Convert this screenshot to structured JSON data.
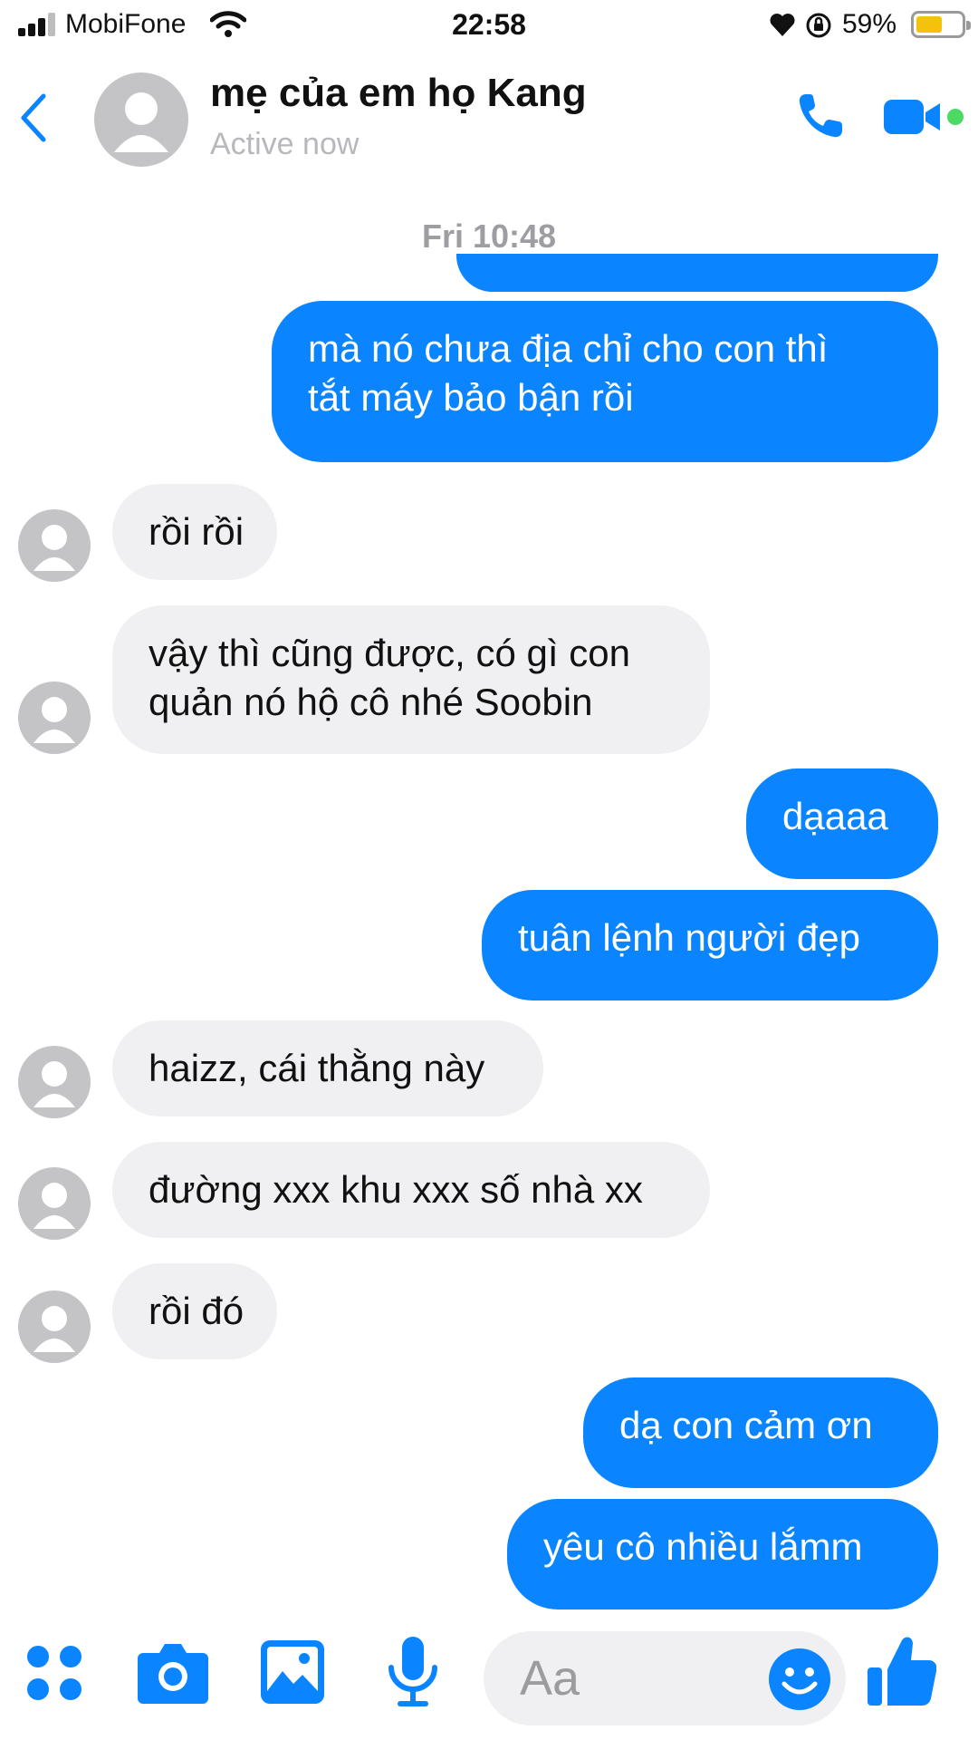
{
  "status_bar": {
    "carrier": "MobiFone",
    "time": "22:58",
    "battery_percent": "59%",
    "battery_level": 0.59,
    "icons": [
      "signal-icon",
      "wifi-icon",
      "heart-icon",
      "rotation-lock-icon",
      "battery-icon"
    ]
  },
  "header": {
    "contact_name": "mẹ của em họ Kang",
    "status": "Active now",
    "icons": [
      "back-icon",
      "avatar",
      "phone-icon",
      "video-call-icon"
    ],
    "online_color": "#4cd964"
  },
  "conversation": {
    "timestamp": "Fri 10:48",
    "messages": [
      {
        "direction": "outgoing",
        "lines": [
          "mà nó chưa địa chỉ cho con thì",
          "tắt máy bảo bận rồi"
        ]
      },
      {
        "direction": "incoming",
        "lines": [
          "rồi rồi"
        ]
      },
      {
        "direction": "incoming",
        "lines": [
          "vậy thì cũng được, có gì con",
          "quản nó hộ cô nhé Soobin"
        ]
      },
      {
        "direction": "outgoing",
        "lines": [
          "dạaaa"
        ]
      },
      {
        "direction": "outgoing",
        "lines": [
          "tuân lệnh người đẹp"
        ]
      },
      {
        "direction": "incoming",
        "lines": [
          "haizz, cái thằng này"
        ]
      },
      {
        "direction": "incoming",
        "lines": [
          "đường xxx khu xxx số nhà xx"
        ]
      },
      {
        "direction": "incoming",
        "lines": [
          "rồi đó"
        ]
      },
      {
        "direction": "outgoing",
        "lines": [
          "dạ con cảm ơn"
        ]
      },
      {
        "direction": "outgoing",
        "lines": [
          "yêu cô nhiều lắmm"
        ]
      }
    ]
  },
  "composer": {
    "placeholder": "Aa",
    "icons": [
      "apps-icon",
      "camera-icon",
      "image-icon",
      "microphone-icon",
      "emoji-icon",
      "thumbs-up-icon"
    ]
  },
  "colors": {
    "accent": "#0a84ff",
    "incoming_bubble": "#f0f0f2",
    "battery_fill": "#f4c20d"
  }
}
